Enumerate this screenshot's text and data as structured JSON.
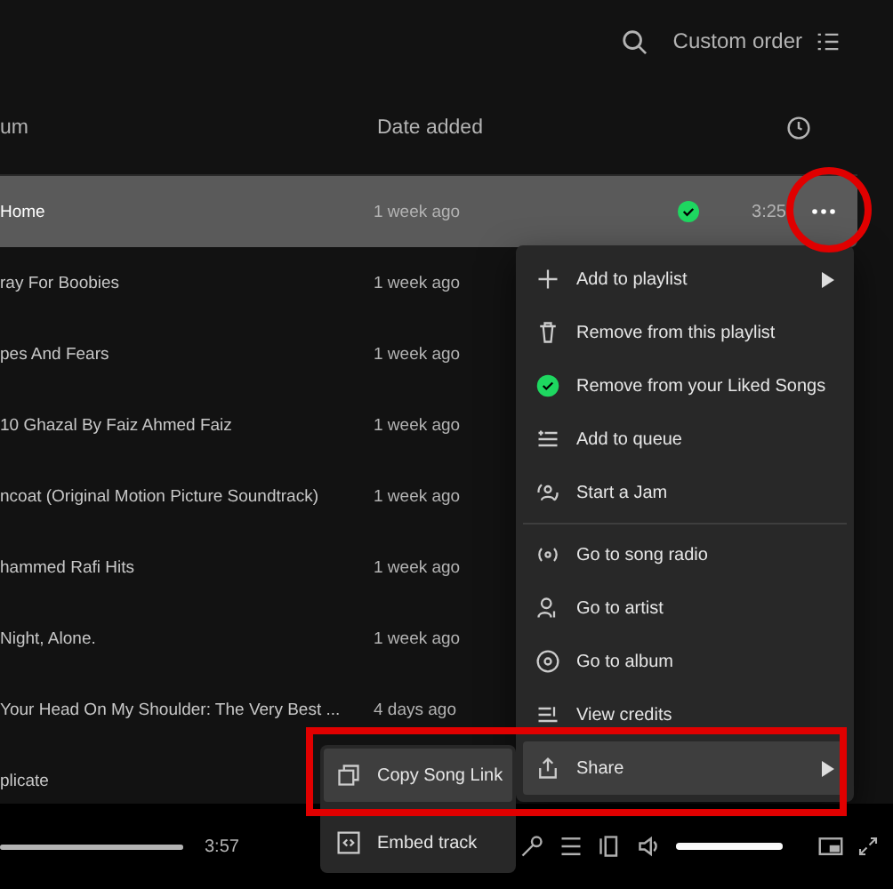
{
  "header": {
    "sort_label": "Custom order"
  },
  "columns": [
    {
      "label": "um"
    },
    {
      "label": "Date added"
    }
  ],
  "rows": [
    {
      "title": "Home",
      "date": "1 week ago",
      "selected": true,
      "liked": true,
      "duration": "3:25"
    },
    {
      "title": "ray For Boobies",
      "date": "1 week ago",
      "selected": false
    },
    {
      "title": "pes And Fears",
      "date": "1 week ago",
      "selected": false
    },
    {
      "title": "10 Ghazal By Faiz Ahmed Faiz",
      "date": "1 week ago",
      "selected": false
    },
    {
      "title": "ncoat (Original Motion Picture Soundtrack)",
      "date": "1 week ago",
      "selected": false
    },
    {
      "title": "hammed Rafi Hits",
      "date": "1 week ago",
      "selected": false
    },
    {
      "title": "Night, Alone.",
      "date": "1 week ago",
      "selected": false
    },
    {
      "title": "Your Head On My Shoulder: The Very Best ...",
      "date": "4 days ago",
      "selected": false
    },
    {
      "title": "plicate",
      "selected": false
    }
  ],
  "context_menu": [
    {
      "label": "Add to playlist",
      "submenu": true,
      "selected": false
    },
    {
      "label": "Remove from this playlist",
      "submenu": false,
      "selected": false
    },
    {
      "label": "Remove from your Liked Songs",
      "submenu": false,
      "selected": false
    },
    {
      "label": "Add to queue",
      "submenu": false,
      "selected": false
    },
    {
      "label": "Start a Jam",
      "submenu": false,
      "selected": false
    },
    {
      "label": "Go to song radio",
      "submenu": false,
      "selected": false
    },
    {
      "label": "Go to artist",
      "submenu": false,
      "selected": false
    },
    {
      "label": "Go to album",
      "submenu": false,
      "selected": false
    },
    {
      "label": "View credits",
      "submenu": false,
      "selected": false
    },
    {
      "label": "Share",
      "submenu": true,
      "selected": true
    }
  ],
  "share_submenu": [
    {
      "label": "Copy Song Link",
      "selected": true
    },
    {
      "label": "Embed track",
      "selected": false
    }
  ],
  "player": {
    "progress": {
      "level": 1
    },
    "duration": "3:57",
    "volume": {
      "level": 1
    }
  }
}
